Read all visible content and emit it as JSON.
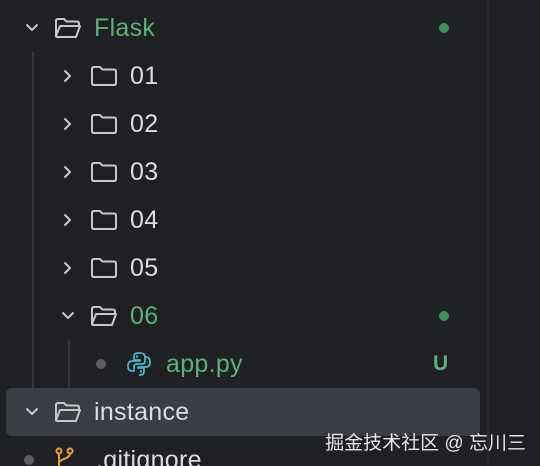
{
  "tree": {
    "root": {
      "label": "Flask",
      "modified_dot_color": "#3f8f5f"
    },
    "folders": [
      {
        "label": "01"
      },
      {
        "label": "02"
      },
      {
        "label": "03"
      },
      {
        "label": "04"
      },
      {
        "label": "05"
      }
    ],
    "open_folder": {
      "label": "06"
    },
    "file": {
      "label": "app.py",
      "status": "U",
      "icon": "python-icon"
    },
    "instance": {
      "label": "instance"
    },
    "gitignore": {
      "label": ".gitignore",
      "icon": "git-icon"
    }
  },
  "watermark": "掘金技术社区 @ 忘川三",
  "colors": {
    "accent_green": "#5fae7c",
    "background": "#1f2023",
    "selected_row": "#3a3d44"
  }
}
